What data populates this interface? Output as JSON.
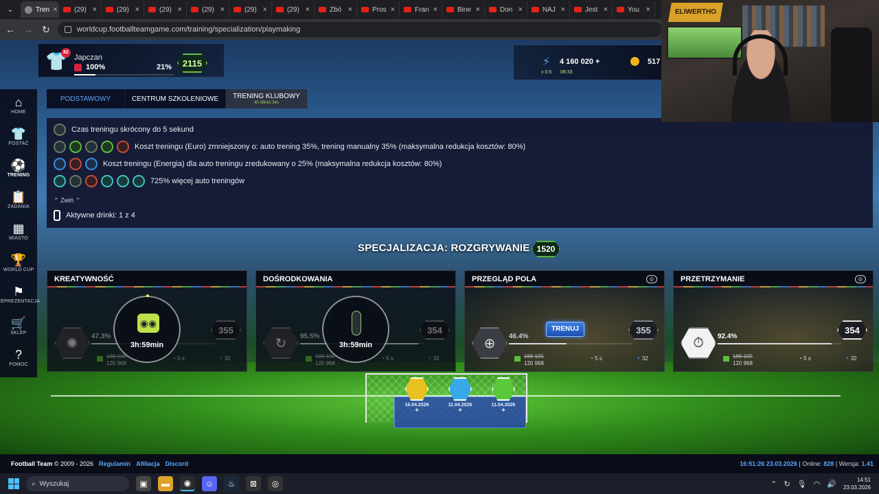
{
  "browser": {
    "tabs": [
      {
        "label": "Tren",
        "icon": "globe-icon",
        "active": true
      },
      {
        "label": "(29)",
        "icon": "youtube-icon"
      },
      {
        "label": "(29)",
        "icon": "youtube-icon"
      },
      {
        "label": "(29)",
        "icon": "youtube-icon"
      },
      {
        "label": "(29)",
        "icon": "youtube-icon"
      },
      {
        "label": "(29)",
        "icon": "youtube-icon"
      },
      {
        "label": "(29)",
        "icon": "youtube-icon"
      },
      {
        "label": "Zbó",
        "icon": "youtube-icon"
      },
      {
        "label": "Pros",
        "icon": "youtube-icon"
      },
      {
        "label": "Fran",
        "icon": "youtube-icon"
      },
      {
        "label": "Bine",
        "icon": "youtube-icon"
      },
      {
        "label": "Don",
        "icon": "youtube-icon"
      },
      {
        "label": "NAJ",
        "icon": "youtube-icon"
      },
      {
        "label": "Jest",
        "icon": "youtube-icon"
      },
      {
        "label": "You",
        "icon": "youtube-icon"
      }
    ],
    "url": "worldcup.footballteamgame.com/training/specialization/playmaking"
  },
  "player": {
    "name": "Japczan",
    "level": "82",
    "flag_pct": "100%",
    "xp_pct": "21%",
    "xp_fraction": 0.21,
    "rank": "2115"
  },
  "resources": {
    "energy": "4 160 020 +",
    "multiplier": "x 0.5",
    "energy_timer": "08:33",
    "coins": "517"
  },
  "nav": [
    {
      "label": "HOME",
      "icon": "house-icon"
    },
    {
      "label": "POSTAĆ",
      "icon": "shirt-icon"
    },
    {
      "label": "TRENING",
      "icon": "ball-icon",
      "active": true
    },
    {
      "label": "ZADANIA",
      "icon": "clipboard-icon"
    },
    {
      "label": "MIASTO",
      "icon": "building-icon"
    },
    {
      "label": "WORLD CUP",
      "icon": "trophy-icon"
    },
    {
      "label": "REPREZENTACJA",
      "icon": "team-icon"
    },
    {
      "label": "SKLEP",
      "icon": "cart-icon"
    },
    {
      "label": "POMOC",
      "icon": "help-icon"
    }
  ],
  "tabs": {
    "basic": "PODSTAWOWY",
    "center": "CENTRUM SZKOLENIOWE",
    "club": "TRENING KLUBOWY",
    "club_timer": "4h 08min 34s"
  },
  "bonuses": {
    "line1": "Czas treningu skrócony do 5 sekund",
    "line2": "Koszt treningu (Euro) zmniejszony o: auto trening 35%, trening manualny 35% (maksymalna redukcja kosztów: 80%)",
    "line3": "Koszt treningu (Energia) dla auto treningu zredukowany o 25% (maksymalna redukcja kosztów: 80%)",
    "line4": "725% więcej auto treningów",
    "collapse": "Zwiń",
    "drinks": "Aktywne drinki: 1 z 4"
  },
  "specialization": {
    "title": "SPECJALIZACJA: ROZGRYWANIE",
    "value": "1520"
  },
  "skills": [
    {
      "name": "KREATYWNOŚĆ",
      "pct": "47.3%",
      "progress": 0.473,
      "value": "355",
      "cost_old": "186 105",
      "cost_new": "120 968",
      "duration": "5 s",
      "energy": "32",
      "timer": "3h:59min",
      "icon": "brain-icon"
    },
    {
      "name": "DOŚRODKOWANIA",
      "pct": "95.5%",
      "progress": 0.955,
      "value": "354",
      "cost_old": "186 105",
      "cost_new": "120 968",
      "duration": "5 s",
      "energy": "32",
      "timer": "3h:59min",
      "icon": "cross-icon"
    },
    {
      "name": "PRZEGLĄD POLA",
      "pct": "46.4%",
      "progress": 0.464,
      "value": "355",
      "cost_old": "186 105",
      "cost_new": "120 968",
      "duration": "5 s",
      "energy": "32",
      "button": "TRENUJ",
      "icon": "target-icon"
    },
    {
      "name": "PRZETRZYMANIE",
      "pct": "92.4%",
      "progress": 0.924,
      "value": "354",
      "cost_old": "186 105",
      "cost_new": "120 968",
      "duration": "5 s",
      "energy": "32",
      "icon": "stopwatch-icon"
    }
  ],
  "drinks": [
    {
      "date": "16.04.2026",
      "color": "#e8c020"
    },
    {
      "date": "11.04.2026",
      "color": "#38a8e8"
    },
    {
      "date": "11.04.2026",
      "color": "#5bc83a"
    }
  ],
  "footer": {
    "brand": "Football Team",
    "copyright": "© 2009 - 2026",
    "links": [
      "Regulamin",
      "Afiliacja",
      "Discord"
    ],
    "clock": "16:51:26 23.03.2026",
    "online_label": "Online:",
    "online": "828",
    "version_label": "Wersja:",
    "version": "1.41"
  },
  "webcam": {
    "logo": "ELIWERTHO"
  },
  "taskbar": {
    "search": "Wyszukaj",
    "time": "14:51",
    "date": "23.03.2026"
  }
}
